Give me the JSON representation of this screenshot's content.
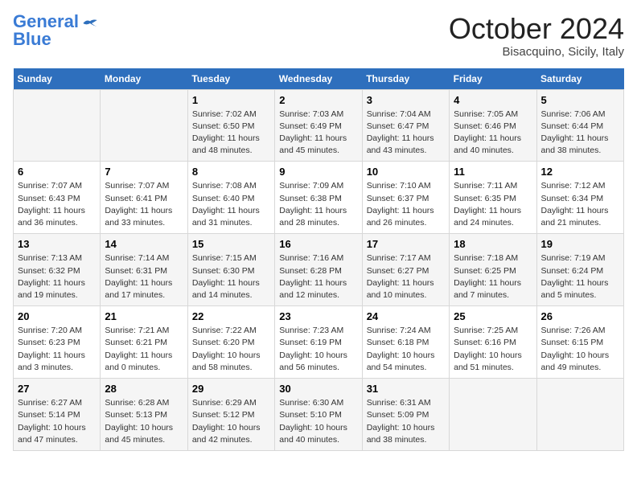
{
  "logo": {
    "line1": "General",
    "line2": "Blue"
  },
  "title": "October 2024",
  "location": "Bisacquino, Sicily, Italy",
  "days_of_week": [
    "Sunday",
    "Monday",
    "Tuesday",
    "Wednesday",
    "Thursday",
    "Friday",
    "Saturday"
  ],
  "weeks": [
    [
      {
        "num": "",
        "info": ""
      },
      {
        "num": "",
        "info": ""
      },
      {
        "num": "1",
        "info": "Sunrise: 7:02 AM\nSunset: 6:50 PM\nDaylight: 11 hours and 48 minutes."
      },
      {
        "num": "2",
        "info": "Sunrise: 7:03 AM\nSunset: 6:49 PM\nDaylight: 11 hours and 45 minutes."
      },
      {
        "num": "3",
        "info": "Sunrise: 7:04 AM\nSunset: 6:47 PM\nDaylight: 11 hours and 43 minutes."
      },
      {
        "num": "4",
        "info": "Sunrise: 7:05 AM\nSunset: 6:46 PM\nDaylight: 11 hours and 40 minutes."
      },
      {
        "num": "5",
        "info": "Sunrise: 7:06 AM\nSunset: 6:44 PM\nDaylight: 11 hours and 38 minutes."
      }
    ],
    [
      {
        "num": "6",
        "info": "Sunrise: 7:07 AM\nSunset: 6:43 PM\nDaylight: 11 hours and 36 minutes."
      },
      {
        "num": "7",
        "info": "Sunrise: 7:07 AM\nSunset: 6:41 PM\nDaylight: 11 hours and 33 minutes."
      },
      {
        "num": "8",
        "info": "Sunrise: 7:08 AM\nSunset: 6:40 PM\nDaylight: 11 hours and 31 minutes."
      },
      {
        "num": "9",
        "info": "Sunrise: 7:09 AM\nSunset: 6:38 PM\nDaylight: 11 hours and 28 minutes."
      },
      {
        "num": "10",
        "info": "Sunrise: 7:10 AM\nSunset: 6:37 PM\nDaylight: 11 hours and 26 minutes."
      },
      {
        "num": "11",
        "info": "Sunrise: 7:11 AM\nSunset: 6:35 PM\nDaylight: 11 hours and 24 minutes."
      },
      {
        "num": "12",
        "info": "Sunrise: 7:12 AM\nSunset: 6:34 PM\nDaylight: 11 hours and 21 minutes."
      }
    ],
    [
      {
        "num": "13",
        "info": "Sunrise: 7:13 AM\nSunset: 6:32 PM\nDaylight: 11 hours and 19 minutes."
      },
      {
        "num": "14",
        "info": "Sunrise: 7:14 AM\nSunset: 6:31 PM\nDaylight: 11 hours and 17 minutes."
      },
      {
        "num": "15",
        "info": "Sunrise: 7:15 AM\nSunset: 6:30 PM\nDaylight: 11 hours and 14 minutes."
      },
      {
        "num": "16",
        "info": "Sunrise: 7:16 AM\nSunset: 6:28 PM\nDaylight: 11 hours and 12 minutes."
      },
      {
        "num": "17",
        "info": "Sunrise: 7:17 AM\nSunset: 6:27 PM\nDaylight: 11 hours and 10 minutes."
      },
      {
        "num": "18",
        "info": "Sunrise: 7:18 AM\nSunset: 6:25 PM\nDaylight: 11 hours and 7 minutes."
      },
      {
        "num": "19",
        "info": "Sunrise: 7:19 AM\nSunset: 6:24 PM\nDaylight: 11 hours and 5 minutes."
      }
    ],
    [
      {
        "num": "20",
        "info": "Sunrise: 7:20 AM\nSunset: 6:23 PM\nDaylight: 11 hours and 3 minutes."
      },
      {
        "num": "21",
        "info": "Sunrise: 7:21 AM\nSunset: 6:21 PM\nDaylight: 11 hours and 0 minutes."
      },
      {
        "num": "22",
        "info": "Sunrise: 7:22 AM\nSunset: 6:20 PM\nDaylight: 10 hours and 58 minutes."
      },
      {
        "num": "23",
        "info": "Sunrise: 7:23 AM\nSunset: 6:19 PM\nDaylight: 10 hours and 56 minutes."
      },
      {
        "num": "24",
        "info": "Sunrise: 7:24 AM\nSunset: 6:18 PM\nDaylight: 10 hours and 54 minutes."
      },
      {
        "num": "25",
        "info": "Sunrise: 7:25 AM\nSunset: 6:16 PM\nDaylight: 10 hours and 51 minutes."
      },
      {
        "num": "26",
        "info": "Sunrise: 7:26 AM\nSunset: 6:15 PM\nDaylight: 10 hours and 49 minutes."
      }
    ],
    [
      {
        "num": "27",
        "info": "Sunrise: 6:27 AM\nSunset: 5:14 PM\nDaylight: 10 hours and 47 minutes."
      },
      {
        "num": "28",
        "info": "Sunrise: 6:28 AM\nSunset: 5:13 PM\nDaylight: 10 hours and 45 minutes."
      },
      {
        "num": "29",
        "info": "Sunrise: 6:29 AM\nSunset: 5:12 PM\nDaylight: 10 hours and 42 minutes."
      },
      {
        "num": "30",
        "info": "Sunrise: 6:30 AM\nSunset: 5:10 PM\nDaylight: 10 hours and 40 minutes."
      },
      {
        "num": "31",
        "info": "Sunrise: 6:31 AM\nSunset: 5:09 PM\nDaylight: 10 hours and 38 minutes."
      },
      {
        "num": "",
        "info": ""
      },
      {
        "num": "",
        "info": ""
      }
    ]
  ]
}
